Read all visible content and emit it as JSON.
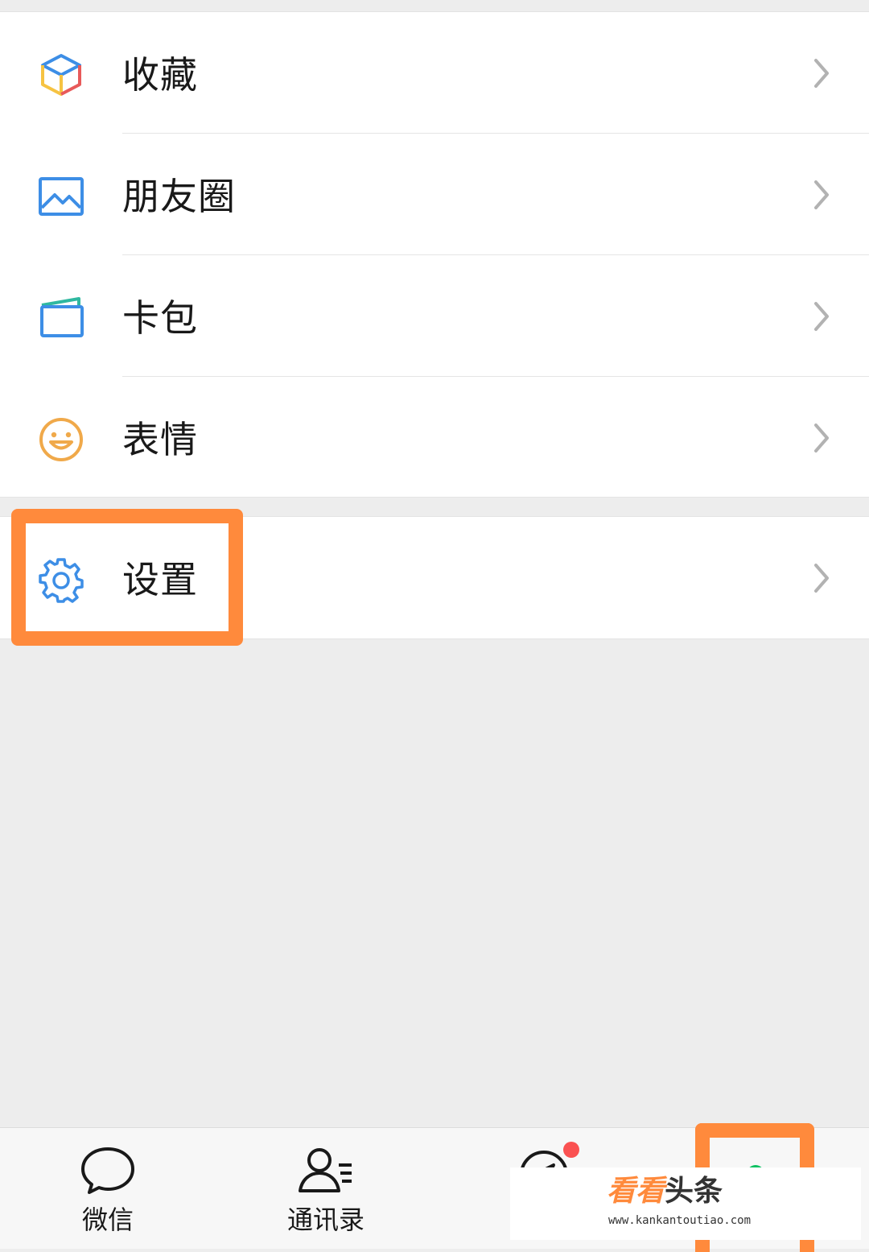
{
  "colors": {
    "page_bg": "#ededed",
    "highlight": "#ff8a3c",
    "wechat_green": "#07c160",
    "badge_red": "#fa5151",
    "chevron": "#b2b2b2"
  },
  "menu": {
    "items": [
      {
        "label": "收藏",
        "icon": "favorites-cube-icon"
      },
      {
        "label": "朋友圈",
        "icon": "moments-image-icon"
      },
      {
        "label": "卡包",
        "icon": "card-wallet-icon"
      },
      {
        "label": "表情",
        "icon": "smiley-face-icon"
      }
    ],
    "settings": {
      "label": "设置",
      "icon": "gear-icon"
    }
  },
  "tabbar": {
    "tabs": [
      {
        "label": "微信",
        "icon": "chat-bubble-icon"
      },
      {
        "label": "通讯录",
        "icon": "contacts-icon"
      },
      {
        "label": "",
        "icon": "discover-compass-icon"
      },
      {
        "label": "",
        "icon": "me-person-icon"
      }
    ]
  },
  "watermark": {
    "brand_a": "看看",
    "brand_b": "头条",
    "url": "www.kankantoutiao.com"
  }
}
